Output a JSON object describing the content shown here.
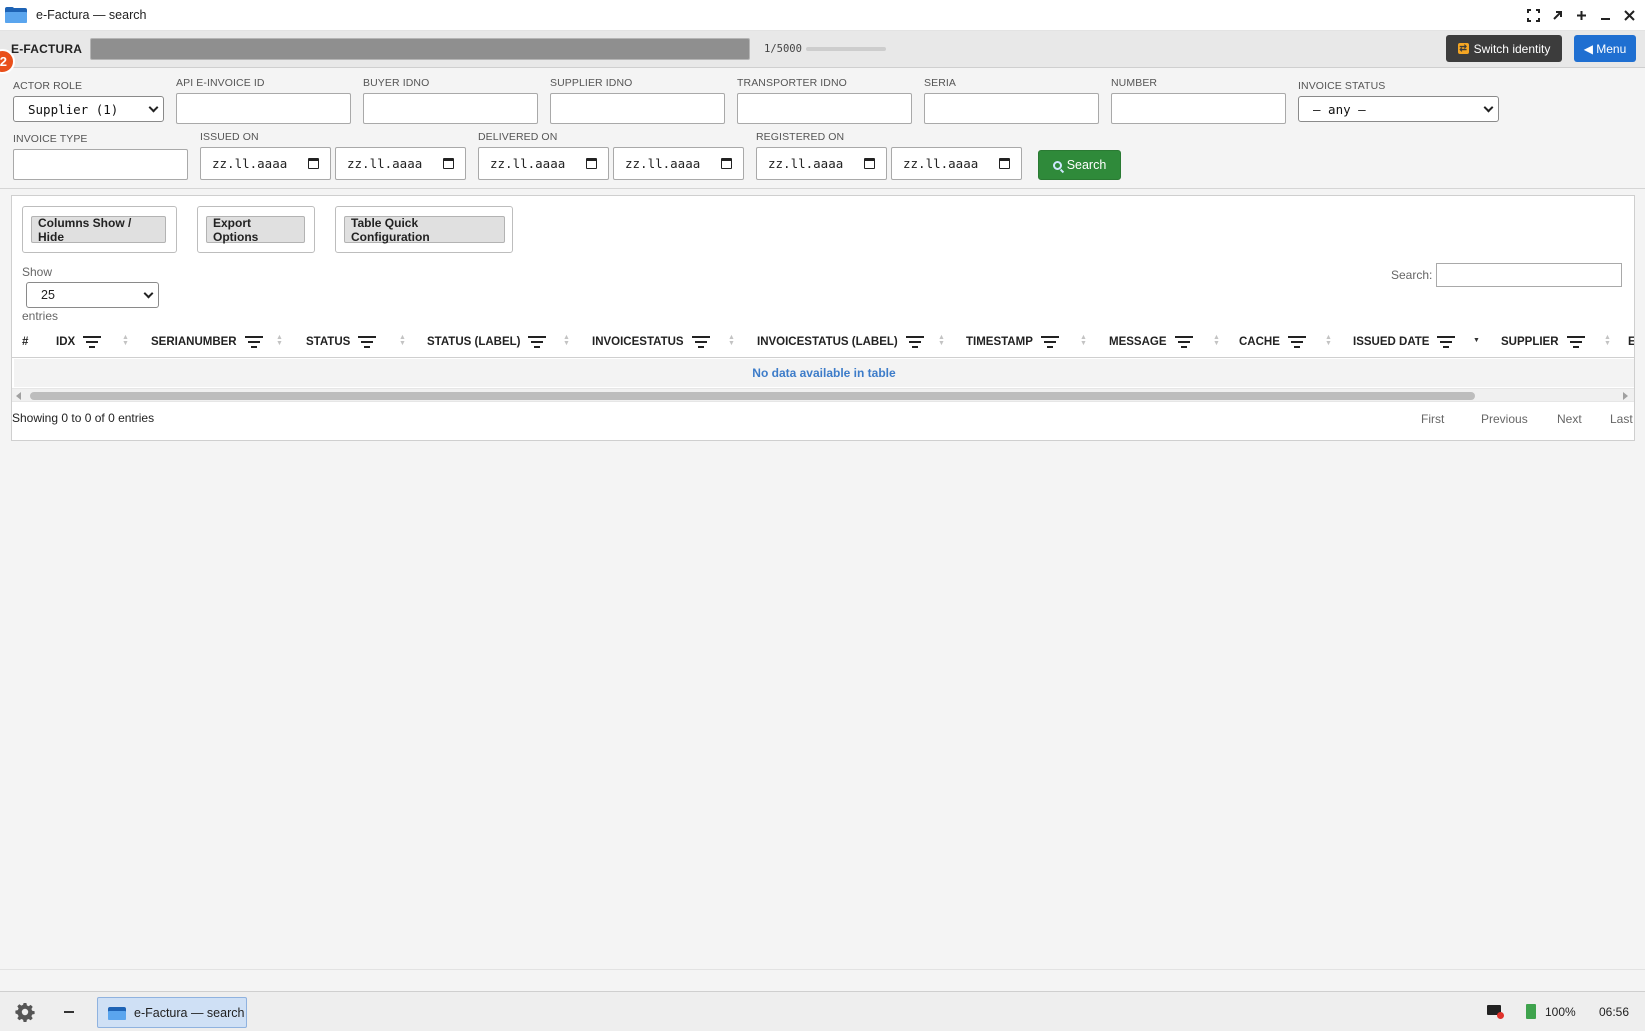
{
  "window": {
    "title": "e-Factura — search",
    "controls": [
      "fullscreen-icon",
      "restore-icon",
      "maximize-icon",
      "minimize-icon",
      "close-icon"
    ]
  },
  "header": {
    "notification_count": "2",
    "brand": "E-FACTURA",
    "progress": "1/5000",
    "switch_identity": "Switch identity",
    "menu": "◀ Menu"
  },
  "filters": {
    "actor_role": {
      "label": "ACTOR ROLE",
      "value": "Supplier (1)"
    },
    "api_invoice_id": {
      "label": "API E-INVOICE ID",
      "value": ""
    },
    "buyer_idno": {
      "label": "BUYER IDNO",
      "value": ""
    },
    "supplier_idno": {
      "label": "SUPPLIER IDNO",
      "value": ""
    },
    "transporter_idno": {
      "label": "TRANSPORTER IDNO",
      "value": ""
    },
    "seria": {
      "label": "SERIA",
      "value": ""
    },
    "number": {
      "label": "NUMBER",
      "value": ""
    },
    "invoice_status": {
      "label": "INVOICE STATUS",
      "value": "— any —"
    },
    "invoice_type": {
      "label": "INVOICE TYPE",
      "value": ""
    },
    "issued_on": {
      "label": "ISSUED ON",
      "from": "zz.ll.aaaa",
      "to": "zz.ll.aaaa"
    },
    "delivered_on": {
      "label": "DELIVERED ON",
      "from": "zz.ll.aaaa",
      "to": "zz.ll.aaaa"
    },
    "registered_on": {
      "label": "REGISTERED ON",
      "from": "zz.ll.aaaa",
      "to": "zz.ll.aaaa"
    },
    "search_button": "Search"
  },
  "table": {
    "buttons": {
      "columns": "Columns Show / Hide",
      "export": "Export Options",
      "quick_config": "Table Quick Configuration"
    },
    "show_label": "Show",
    "page_length": "25",
    "entries_label": "entries",
    "search_label": "Search:",
    "columns": [
      "#",
      "IDX",
      "SERIANUMBER",
      "STATUS",
      "STATUS (LABEL)",
      "INVOICESTATUS",
      "INVOICESTATUS (LABEL)",
      "TIMESTAMP",
      "MESSAGE",
      "CACHE",
      "ISSUED DATE",
      "SUPPLIER",
      "E"
    ],
    "empty_message": "No data available in table",
    "info": "Showing 0 to 0 of 0 entries",
    "pager": {
      "first": "First",
      "previous": "Previous",
      "next": "Next",
      "last": "Last"
    }
  },
  "taskbar": {
    "task_label": "e-Factura — search",
    "battery": "100%",
    "clock": "06:56"
  }
}
